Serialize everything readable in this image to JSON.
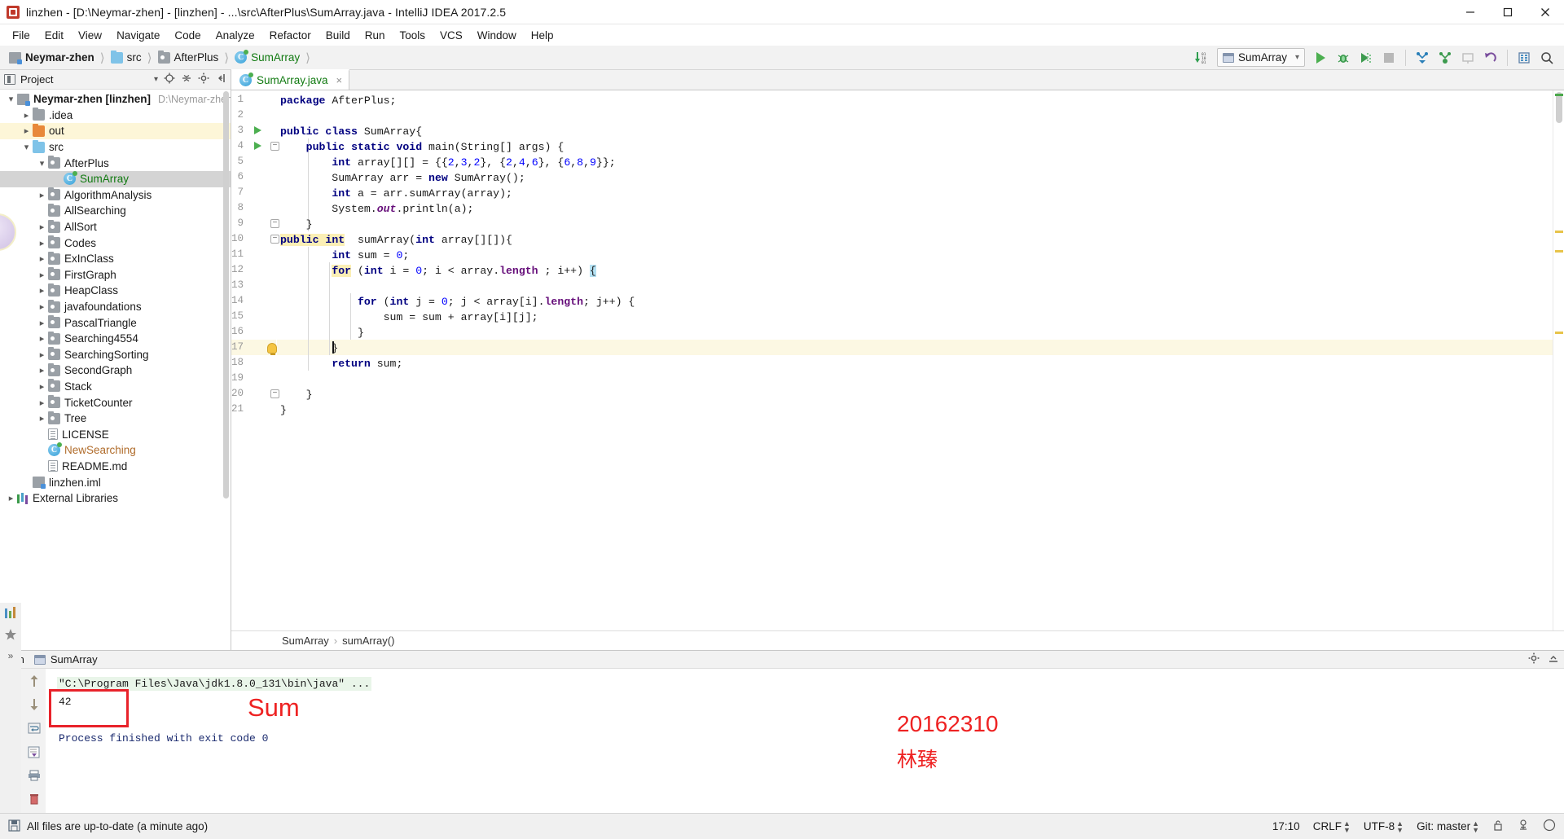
{
  "window": {
    "title": "linzhen - [D:\\Neymar-zhen] - [linzhen] - ...\\src\\AfterPlus\\SumArray.java - IntelliJ IDEA 2017.2.5",
    "app_icon": "intellij-idea-icon",
    "minimize_label": "Minimize",
    "maximize_label": "Maximize",
    "close_label": "Close"
  },
  "menubar": {
    "items": [
      {
        "label": "File"
      },
      {
        "label": "Edit"
      },
      {
        "label": "View"
      },
      {
        "label": "Navigate"
      },
      {
        "label": "Code"
      },
      {
        "label": "Analyze"
      },
      {
        "label": "Refactor"
      },
      {
        "label": "Build"
      },
      {
        "label": "Run"
      },
      {
        "label": "Tools"
      },
      {
        "label": "VCS"
      },
      {
        "label": "Window"
      },
      {
        "label": "Help"
      }
    ]
  },
  "navbar": {
    "breadcrumb": [
      {
        "label": "Neymar-zhen",
        "icon": "module-icon",
        "style": "bold"
      },
      {
        "label": "src",
        "icon": "folder-src-icon",
        "style": "normal"
      },
      {
        "label": "AfterPlus",
        "icon": "package-icon",
        "style": "normal"
      },
      {
        "label": "SumArray",
        "icon": "java-class-icon",
        "style": "green"
      }
    ],
    "toolbar": {
      "update_label": "update-project-icon",
      "run_config_name": "SumArray",
      "run_config_icon": "run-configuration-icon",
      "buttons": [
        {
          "name": "run-button",
          "icon": "play-icon"
        },
        {
          "name": "debug-button",
          "icon": "bug-icon"
        },
        {
          "name": "run-coverage-button",
          "icon": "coverage-icon"
        },
        {
          "name": "stop-button",
          "icon": "stop-icon"
        },
        {
          "name": "update-app-button",
          "icon": "update-icon"
        },
        {
          "name": "commit-button",
          "icon": "commit-icon"
        },
        {
          "name": "push-button",
          "icon": "push-icon"
        },
        {
          "name": "rollback-button",
          "icon": "revert-icon"
        },
        {
          "name": "settings-button",
          "icon": "settings-icon"
        },
        {
          "name": "search-everywhere-button",
          "icon": "search-icon"
        }
      ]
    }
  },
  "project_panel": {
    "title": "Project",
    "header_icons": [
      "chevron-down-icon",
      "locate-icon",
      "collapse-all-icon",
      "gear-icon",
      "hide-icon"
    ],
    "tree": [
      {
        "label": "Neymar-zhen [linzhen]",
        "path": "D:\\Neymar-zhen",
        "icon": "module-icon",
        "indent": 0,
        "twisty": "expanded",
        "style": "bold",
        "state": "normal"
      },
      {
        "label": ".idea",
        "icon": "folder-icon",
        "indent": 1,
        "twisty": "collapsed",
        "style": "normal",
        "state": "normal"
      },
      {
        "label": "out",
        "icon": "folder-out-icon",
        "indent": 1,
        "twisty": "collapsed",
        "style": "normal",
        "state": "highlight"
      },
      {
        "label": "src",
        "icon": "folder-src-icon",
        "indent": 1,
        "twisty": "expanded",
        "style": "normal",
        "state": "normal"
      },
      {
        "label": "AfterPlus",
        "icon": "package-icon",
        "indent": 2,
        "twisty": "expanded",
        "style": "normal",
        "state": "normal"
      },
      {
        "label": "SumArray",
        "icon": "java-class-icon",
        "indent": 3,
        "twisty": "none",
        "style": "green",
        "state": "selected"
      },
      {
        "label": "AlgorithmAnalysis",
        "icon": "package-icon",
        "indent": 2,
        "twisty": "collapsed",
        "style": "normal",
        "state": "normal"
      },
      {
        "label": "AllSearching",
        "icon": "package-icon",
        "indent": 2,
        "twisty": "none",
        "style": "normal",
        "state": "normal"
      },
      {
        "label": "AllSort",
        "icon": "package-icon",
        "indent": 2,
        "twisty": "collapsed",
        "style": "normal",
        "state": "normal"
      },
      {
        "label": "Codes",
        "icon": "package-icon",
        "indent": 2,
        "twisty": "collapsed",
        "style": "normal",
        "state": "normal"
      },
      {
        "label": "ExInClass",
        "icon": "package-icon",
        "indent": 2,
        "twisty": "collapsed",
        "style": "normal",
        "state": "normal"
      },
      {
        "label": "FirstGraph",
        "icon": "package-icon",
        "indent": 2,
        "twisty": "collapsed",
        "style": "normal",
        "state": "normal"
      },
      {
        "label": "HeapClass",
        "icon": "package-icon",
        "indent": 2,
        "twisty": "collapsed",
        "style": "normal",
        "state": "normal"
      },
      {
        "label": "javafoundations",
        "icon": "package-icon",
        "indent": 2,
        "twisty": "collapsed",
        "style": "normal",
        "state": "normal"
      },
      {
        "label": "PascalTriangle",
        "icon": "package-icon",
        "indent": 2,
        "twisty": "collapsed",
        "style": "normal",
        "state": "normal"
      },
      {
        "label": "Searching4554",
        "icon": "package-icon",
        "indent": 2,
        "twisty": "collapsed",
        "style": "normal",
        "state": "normal"
      },
      {
        "label": "SearchingSorting",
        "icon": "package-icon",
        "indent": 2,
        "twisty": "collapsed",
        "style": "normal",
        "state": "normal"
      },
      {
        "label": "SecondGraph",
        "icon": "package-icon",
        "indent": 2,
        "twisty": "collapsed",
        "style": "normal",
        "state": "normal"
      },
      {
        "label": "Stack",
        "icon": "package-icon",
        "indent": 2,
        "twisty": "collapsed",
        "style": "normal",
        "state": "normal"
      },
      {
        "label": "TicketCounter",
        "icon": "package-icon",
        "indent": 2,
        "twisty": "collapsed",
        "style": "normal",
        "state": "normal"
      },
      {
        "label": "Tree",
        "icon": "package-icon",
        "indent": 2,
        "twisty": "collapsed",
        "style": "normal",
        "state": "normal"
      },
      {
        "label": "LICENSE",
        "icon": "text-file-icon",
        "indent": 2,
        "twisty": "none",
        "style": "normal",
        "state": "normal"
      },
      {
        "label": "NewSearching",
        "icon": "java-class-icon",
        "indent": 2,
        "twisty": "none",
        "style": "brown",
        "state": "normal"
      },
      {
        "label": "README.md",
        "icon": "text-file-icon",
        "indent": 2,
        "twisty": "none",
        "style": "normal",
        "state": "normal"
      },
      {
        "label": "linzhen.iml",
        "icon": "module-file-icon",
        "indent": 1,
        "twisty": "none",
        "style": "normal",
        "state": "normal"
      },
      {
        "label": "External Libraries",
        "icon": "libraries-icon",
        "indent": 0,
        "twisty": "collapsed",
        "style": "normal",
        "state": "normal"
      }
    ]
  },
  "editor": {
    "tab": {
      "label": "SumArray.java",
      "icon": "java-class-icon",
      "close": "×"
    },
    "lines": [
      {
        "n": 1,
        "text": "package AfterPlus;"
      },
      {
        "n": 2,
        "text": ""
      },
      {
        "n": 3,
        "text": "public class SumArray{"
      },
      {
        "n": 4,
        "text": "    public static void main(String[] args) {"
      },
      {
        "n": 5,
        "text": "        int array[][] = {{2,3,2}, {2,4,6}, {6,8,9}};"
      },
      {
        "n": 6,
        "text": "        SumArray arr = new SumArray();"
      },
      {
        "n": 7,
        "text": "        int a = arr.sumArray(array);"
      },
      {
        "n": 8,
        "text": "        System.out.println(a);"
      },
      {
        "n": 9,
        "text": "    }"
      },
      {
        "n": 10,
        "text": "public int  sumArray(int array[][]){"
      },
      {
        "n": 11,
        "text": "        int sum = 0;"
      },
      {
        "n": 12,
        "text": "        for (int i = 0; i < array.length ; i++) {"
      },
      {
        "n": 13,
        "text": ""
      },
      {
        "n": 14,
        "text": "            for (int j = 0; j < array[i].length; j++) {"
      },
      {
        "n": 15,
        "text": "                sum = sum + array[i][j];"
      },
      {
        "n": 16,
        "text": "            }"
      },
      {
        "n": 17,
        "text": "        }"
      },
      {
        "n": 18,
        "text": "        return sum;"
      },
      {
        "n": 19,
        "text": ""
      },
      {
        "n": 20,
        "text": "    }"
      },
      {
        "n": 21,
        "text": "}"
      }
    ],
    "caret_line": 17,
    "breadcrumb": {
      "class": "SumArray",
      "method": "sumArray()",
      "separator": "›"
    }
  },
  "run_panel": {
    "title": "Run",
    "tab_label": "SumArray",
    "tab_icon": "run-configuration-icon",
    "console": {
      "command": "\"C:\\Program Files\\Java\\jdk1.8.0_131\\bin\\java\" ...",
      "output": "42",
      "process": "Process finished with exit code 0"
    },
    "annotations": [
      {
        "text": "Sum",
        "color": "#ee2222",
        "name": "sum-annotation"
      },
      {
        "text": "20162310",
        "color": "#ee2222",
        "name": "student-id-annotation"
      },
      {
        "text": "林臻",
        "color": "#ee2222",
        "name": "student-name-annotation"
      }
    ],
    "highlight_box_color": "#e8222a",
    "side_buttons": [
      {
        "name": "rerun-button",
        "icon": "play-icon"
      },
      {
        "name": "stop-button",
        "icon": "stop-icon"
      },
      {
        "name": "pause-button",
        "icon": "pause-icon"
      },
      {
        "name": "print-button",
        "icon": "camera-icon"
      },
      {
        "name": "export-button",
        "icon": "export-icon"
      },
      {
        "name": "close-button",
        "icon": "close-icon"
      }
    ],
    "nav_buttons": [
      {
        "name": "up-button",
        "icon": "arrow-up-icon"
      },
      {
        "name": "down-button",
        "icon": "arrow-down-icon"
      },
      {
        "name": "soft-wrap-button",
        "icon": "wrap-icon"
      },
      {
        "name": "scroll-to-end-button",
        "icon": "scroll-end-icon"
      },
      {
        "name": "print-button",
        "icon": "printer-icon"
      },
      {
        "name": "clear-all-button",
        "icon": "trash-icon"
      }
    ]
  },
  "left_rail": {
    "buttons": [
      {
        "name": "structure-button",
        "icon": "structure-icon"
      },
      {
        "name": "favorites-button",
        "icon": "favorites-icon"
      },
      {
        "name": "more-button",
        "icon": "chevrons-right-icon",
        "label": "»"
      }
    ]
  },
  "statusbar": {
    "message": "All files are up-to-date (a minute ago)",
    "message_icon": "save-all-icon",
    "position": "17:10",
    "line_separator": "CRLF",
    "encoding": "UTF-8",
    "branch": "Git: master",
    "lock_icon": "lock-icon",
    "inspections_icon": "inspections-icon",
    "event_log_icon": "event-log-icon"
  },
  "colors": {
    "accent_green": "#4caf50",
    "keyword_blue": "#000080",
    "number_blue": "#0000ff",
    "field_purple": "#660e7a",
    "class_green": "#117a11",
    "annotation_red": "#ee2222",
    "selection_grey": "#d4d4d4",
    "caret_row_yellow": "#fcf8e3"
  }
}
